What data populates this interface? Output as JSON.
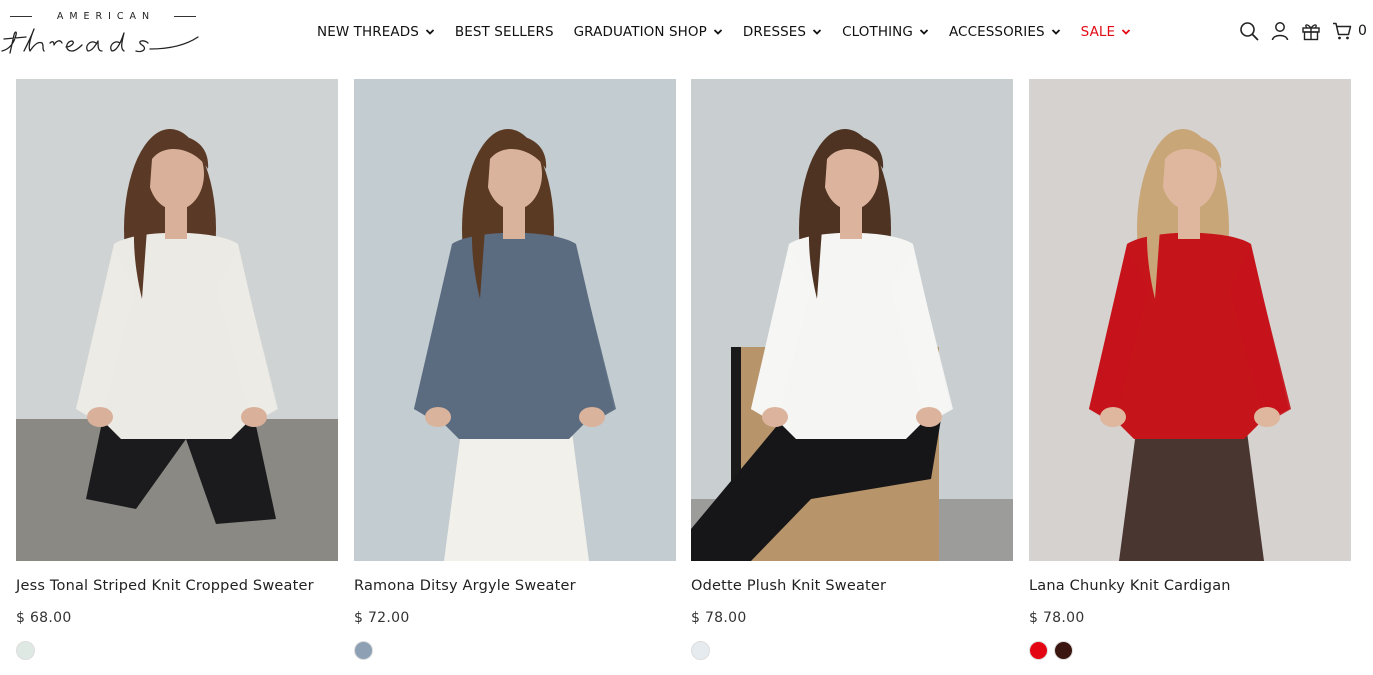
{
  "brand": {
    "top": "AMERICAN",
    "script": "threads"
  },
  "nav": [
    {
      "label": "NEW THREADS",
      "dropdown": true
    },
    {
      "label": "BEST SELLERS",
      "dropdown": false
    },
    {
      "label": "GRADUATION SHOP",
      "dropdown": true
    },
    {
      "label": "DRESSES",
      "dropdown": true
    },
    {
      "label": "CLOTHING",
      "dropdown": true
    },
    {
      "label": "ACCESSORIES",
      "dropdown": true
    },
    {
      "label": "SALE",
      "dropdown": true,
      "color": "#e30a14"
    }
  ],
  "header_icons": [
    "search-icon",
    "account-icon",
    "gift-icon",
    "cart-icon"
  ],
  "cart": {
    "count": "0"
  },
  "products": [
    {
      "title": "Jess Tonal Striped Knit Cropped Sweater",
      "price": "$ 68.00",
      "swatches": [
        "#dfe9e4"
      ],
      "photo": {
        "bg": "#cfd3d4",
        "floor": "#8b8984",
        "top": "#eceae5",
        "bottom": "#1b1b1d",
        "hair": "#5a3a26",
        "skin": "#d9b19a",
        "pose": "kneel"
      }
    },
    {
      "title": "Ramona Ditsy Argyle Sweater",
      "price": "$ 72.00",
      "swatches": [
        "#8da0b4"
      ],
      "photo": {
        "bg": "#c3ccd0",
        "floor": "#c3ccd0",
        "top": "#5b6b80",
        "bottom": "#f2f0eb",
        "hair": "#5b3a24",
        "skin": "#dab39c",
        "pose": "stand"
      }
    },
    {
      "title": "Odette Plush Knit Sweater",
      "price": "$ 78.00",
      "swatches": [
        "#e6ebef"
      ],
      "photo": {
        "bg": "#c9ced1",
        "floor": "#9c9d9b",
        "top": "#f5f5f4",
        "bottom": "#161618",
        "hair": "#4e3322",
        "skin": "#dcb49d",
        "pose": "sit"
      }
    },
    {
      "title": "Lana Chunky Knit Cardigan",
      "price": "$ 78.00",
      "swatches": [
        "#e30612",
        "#3b1610"
      ],
      "photo": {
        "bg": "#d5d2cf",
        "floor": "#d5d2cf",
        "top": "#c6141b",
        "bottom": "#4a3630",
        "hair": "#c9a678",
        "skin": "#dfb79e",
        "pose": "stand"
      }
    }
  ]
}
